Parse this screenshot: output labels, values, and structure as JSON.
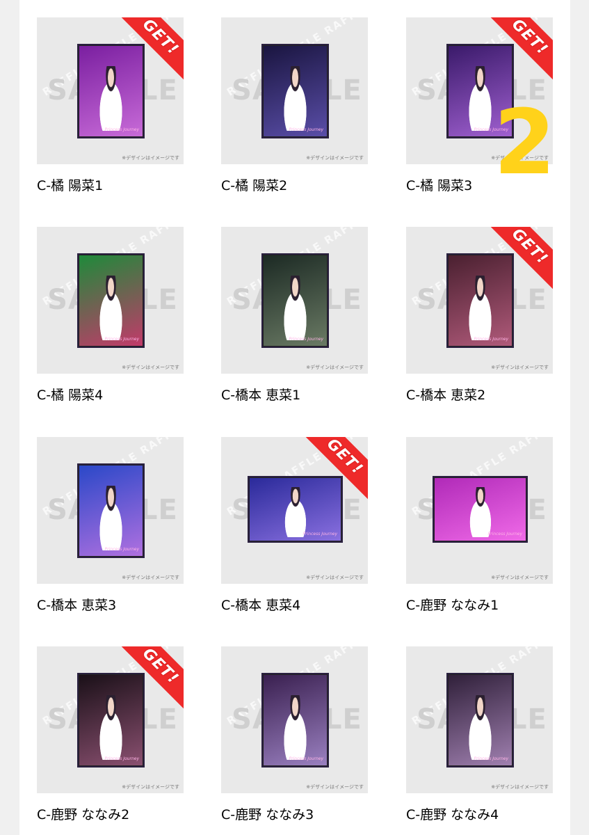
{
  "watermark": {
    "sample": "SAMPLE",
    "raffle": "RAFFLE RAFFLE RAFFLE RAFFLE"
  },
  "note": "※デザインはイメージです",
  "badge": "GET!",
  "photo_logo": "Princess Journey",
  "annotation": "2",
  "items": [
    {
      "name": "C-橘 陽菜1",
      "get": true,
      "orientation": "portrait",
      "colors": [
        "#7a1fa0",
        "#c86bd8"
      ]
    },
    {
      "name": "C-橘 陽菜2",
      "get": false,
      "orientation": "portrait",
      "colors": [
        "#1a1540",
        "#5a4ea8"
      ]
    },
    {
      "name": "C-橘 陽菜3",
      "get": true,
      "orientation": "portrait",
      "colors": [
        "#3a1a6a",
        "#a060d0"
      ]
    },
    {
      "name": "C-橘 陽菜4",
      "get": false,
      "orientation": "portrait",
      "colors": [
        "#1e8a3a",
        "#c23a6a"
      ]
    },
    {
      "name": "C-橋本 恵菜1",
      "get": false,
      "orientation": "portrait",
      "colors": [
        "#1c2a24",
        "#6a7a64"
      ]
    },
    {
      "name": "C-橋本 恵菜2",
      "get": true,
      "orientation": "portrait",
      "colors": [
        "#4a2030",
        "#b05a7a"
      ]
    },
    {
      "name": "C-橋本 恵菜3",
      "get": false,
      "orientation": "portrait",
      "colors": [
        "#2a48c8",
        "#b070e0"
      ]
    },
    {
      "name": "C-橋本 恵菜4",
      "get": true,
      "orientation": "landscape",
      "colors": [
        "#2a2a9a",
        "#8a70e0"
      ]
    },
    {
      "name": "C-鹿野 ななみ1",
      "get": false,
      "orientation": "landscape",
      "colors": [
        "#b02ab8",
        "#f06ae8"
      ]
    },
    {
      "name": "C-鹿野 ななみ2",
      "get": true,
      "orientation": "portrait",
      "colors": [
        "#1a1018",
        "#8a5070"
      ]
    },
    {
      "name": "C-鹿野 ななみ3",
      "get": false,
      "orientation": "portrait",
      "colors": [
        "#3a2050",
        "#9a80c0"
      ]
    },
    {
      "name": "C-鹿野 ななみ4",
      "get": false,
      "orientation": "portrait",
      "colors": [
        "#30203a",
        "#a080b0"
      ]
    }
  ]
}
